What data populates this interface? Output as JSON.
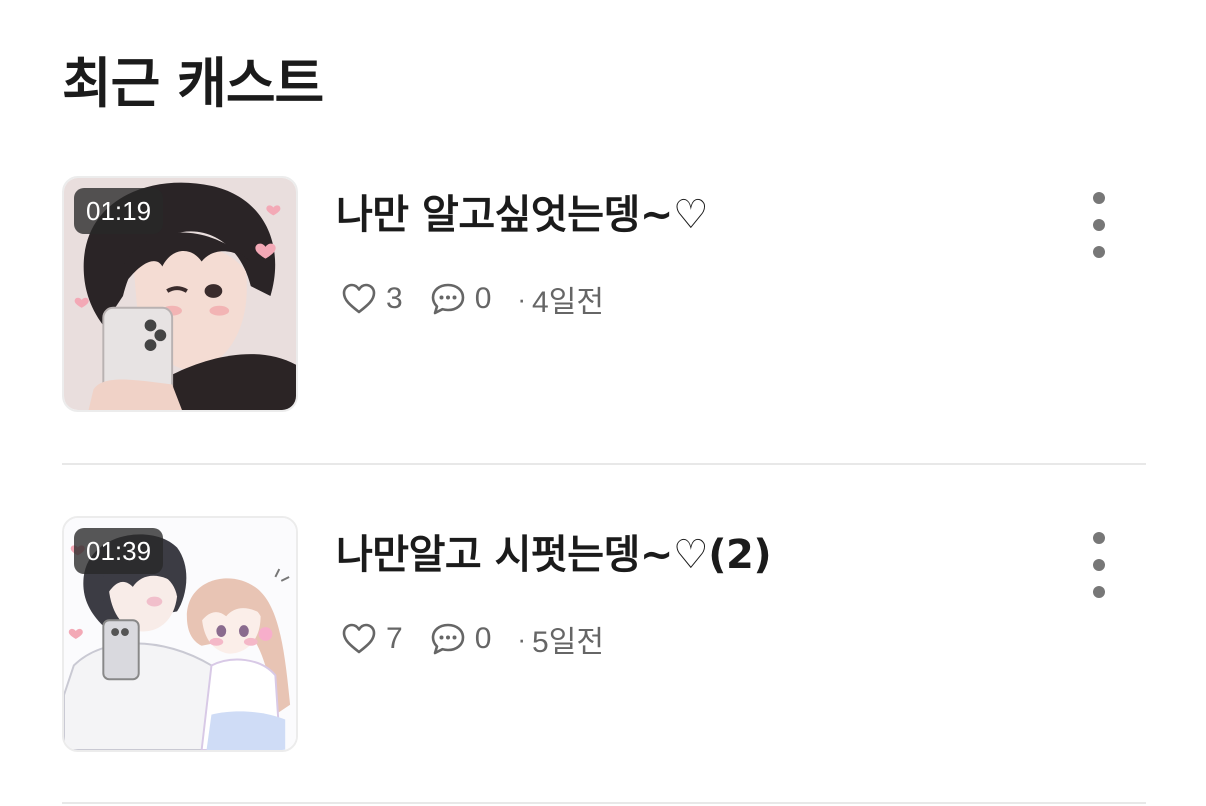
{
  "section": {
    "title": "최근 캐스트"
  },
  "casts": [
    {
      "duration": "01:19",
      "title": "나만 알고싶엇는뎅~♡",
      "likes": "3",
      "comments": "0",
      "time_ago": "4일전",
      "thumbnail_icon": "anime-boy-selfie"
    },
    {
      "duration": "01:39",
      "title": "나만알고 시펏는뎅~♡(2)",
      "likes": "7",
      "comments": "0",
      "time_ago": "5일전",
      "thumbnail_icon": "anime-couple-selfie"
    }
  ],
  "colors": {
    "text_primary": "#1b1b1b",
    "text_secondary": "#666666",
    "divider": "#e8e8e8",
    "duration_badge": "#282828"
  },
  "meta_separator": "·"
}
